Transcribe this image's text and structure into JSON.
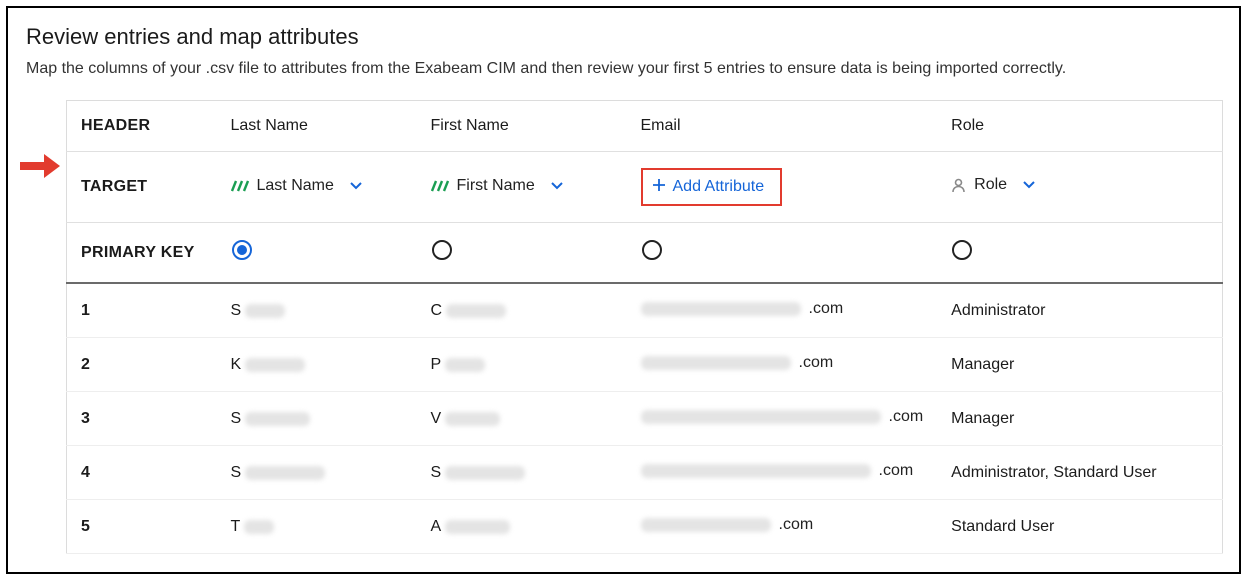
{
  "title": "Review entries and map attributes",
  "subtitle": "Map the columns of your .csv file to attributes from the Exabeam CIM and then review your first 5 entries to ensure data is being imported correctly.",
  "row_labels": {
    "header": "HEADER",
    "target": "TARGET",
    "primary_key": "PRIMARY KEY"
  },
  "columns": [
    {
      "key": "last_name",
      "header": "Last Name",
      "target_label": "Last Name",
      "target_kind": "mapped-stripes",
      "primary_key_selected": true
    },
    {
      "key": "first_name",
      "header": "First Name",
      "target_label": "First Name",
      "target_kind": "mapped-stripes",
      "primary_key_selected": false
    },
    {
      "key": "email",
      "header": "Email",
      "target_label": "Add Attribute",
      "target_kind": "add",
      "primary_key_selected": false
    },
    {
      "key": "role",
      "header": "Role",
      "target_label": "Role",
      "target_kind": "mapped-person",
      "primary_key_selected": false
    }
  ],
  "rows": [
    {
      "idx": "1",
      "last_name_initial": "S",
      "first_name_initial": "C",
      "email_suffix": ".com",
      "role": "Administrator"
    },
    {
      "idx": "2",
      "last_name_initial": "K",
      "first_name_initial": "P",
      "email_suffix": ".com",
      "role": "Manager"
    },
    {
      "idx": "3",
      "last_name_initial": "S",
      "first_name_initial": "V",
      "email_suffix": ".com",
      "role": "Manager"
    },
    {
      "idx": "4",
      "last_name_initial": "S",
      "first_name_initial": "S",
      "email_suffix": ".com",
      "role": "Administrator, Standard User"
    },
    {
      "idx": "5",
      "last_name_initial": "T",
      "first_name_initial": "A",
      "email_suffix": ".com",
      "role": "Standard User"
    }
  ],
  "colors": {
    "link": "#1565d8",
    "callout_border": "#e23b2e",
    "arrow": "#e23b2e"
  }
}
